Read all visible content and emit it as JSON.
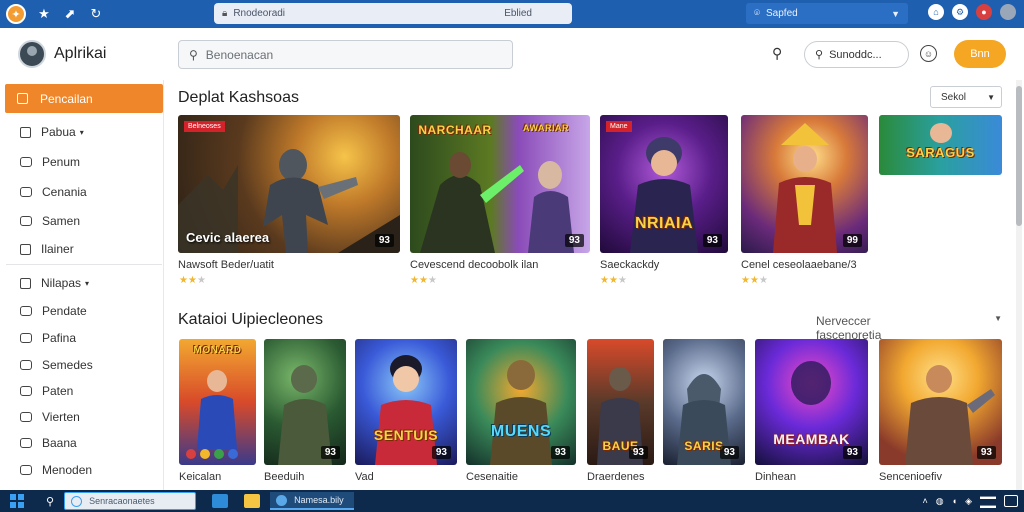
{
  "browser": {
    "address_left": "Rnodeoradi",
    "address_right": "Eblied",
    "profile": "Sapfed"
  },
  "header": {
    "brand": "Aplrikai",
    "search_placeholder": "Benoenacan",
    "pill_text": "Sunoddc...",
    "cta": "Bnn"
  },
  "sidebar": {
    "active": "Pencailan",
    "group1": "Pabua",
    "items1": [
      "Penum",
      "Cenania",
      "Samen",
      "Ilainer"
    ],
    "group2": "Nilapas",
    "items2": [
      "Pendate",
      "Pafina",
      "Semedes",
      "Paten",
      "Vierten",
      "Baana",
      "Menoden"
    ]
  },
  "section1": {
    "title": "Deplat Kashsoas",
    "sort": "Sekol",
    "cards": [
      {
        "ribbon": "Belneoses",
        "title": "Cevic alaerea",
        "rating": "93",
        "caption": "Nawsoft Beder/uatit"
      },
      {
        "logo": "NARCHAAR",
        "logo2": "AWARIAR",
        "rating": "93",
        "caption": "Cevescend decoobolk ilan"
      },
      {
        "ribbon": "Mane",
        "logo": "NRIAIA",
        "rating": "93",
        "caption": "Saeckackdy"
      },
      {
        "rating": "99",
        "caption": "Cenel ceseolaaebane/3"
      },
      {
        "logo": "SARAGUS"
      }
    ]
  },
  "section2": {
    "title": "Kataioi Uipiecleones",
    "filter": "Nerveccer fascenoretia",
    "cards": [
      {
        "logo": "MONARD",
        "caption": "Keicalan"
      },
      {
        "rating": "93",
        "caption": "Beeduih"
      },
      {
        "logo": "SENTUIS",
        "rating": "93",
        "caption": "Vad"
      },
      {
        "logo": "MUENS",
        "rating": "93",
        "caption": "Cesenaitie"
      },
      {
        "logo": "BAUE",
        "rating": "93",
        "caption": "Draerdenes"
      },
      {
        "logo": "SARIS",
        "rating": "93"
      },
      {
        "logo": "MEAMBAK",
        "rating": "93",
        "caption": "Dinhean"
      },
      {
        "rating": "93",
        "caption": "Sencenioefiv"
      }
    ]
  },
  "taskbar": {
    "search": "Senracaonaetes",
    "active_app": "Namesa.bily"
  },
  "colors": {
    "accent": "#f0862a",
    "cta": "#f5a623",
    "topbar": "#1f5fb0",
    "taskbar": "#0d2a4d",
    "star": "#f2b72b"
  },
  "icons": [
    "logo-icon",
    "star-icon",
    "rocket-icon",
    "refresh-icon",
    "lock-icon",
    "search-icon",
    "smile-icon",
    "home-icon",
    "settings-icon",
    "avatar-icon",
    "windows-start-icon"
  ]
}
